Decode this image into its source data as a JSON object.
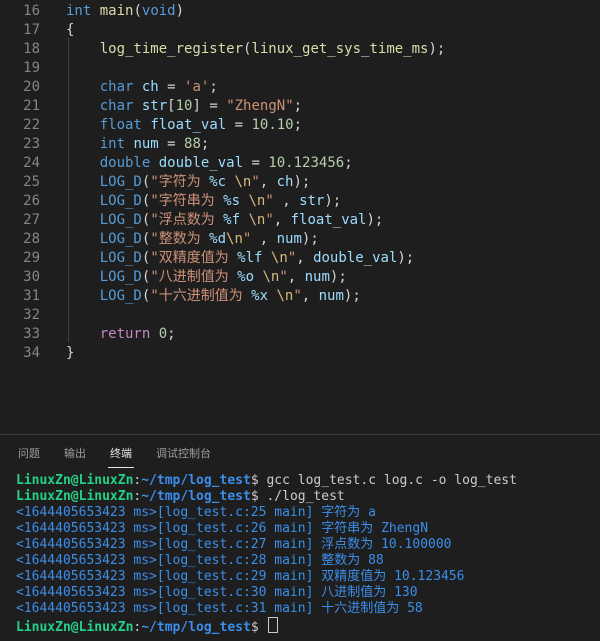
{
  "editor": {
    "lines": [
      {
        "n": "16",
        "t": [
          [
            "kw",
            "int"
          ],
          [
            "pun",
            " "
          ],
          [
            "fn",
            "main"
          ],
          [
            "pun",
            "("
          ],
          [
            "kw",
            "void"
          ],
          [
            "pun",
            ")"
          ]
        ]
      },
      {
        "n": "17",
        "t": [
          [
            "pun",
            "{"
          ]
        ]
      },
      {
        "n": "18",
        "t": [
          [
            "pun",
            "    "
          ],
          [
            "fn",
            "log_time_register"
          ],
          [
            "pun",
            "("
          ],
          [
            "fn",
            "linux_get_sys_time_ms"
          ],
          [
            "pun",
            ");"
          ]
        ]
      },
      {
        "n": "19",
        "t": []
      },
      {
        "n": "20",
        "t": [
          [
            "pun",
            "    "
          ],
          [
            "kw",
            "char"
          ],
          [
            "pun",
            " "
          ],
          [
            "var",
            "ch"
          ],
          [
            "pun",
            " = "
          ],
          [
            "str",
            "'a'"
          ],
          [
            "pun",
            ";"
          ]
        ]
      },
      {
        "n": "21",
        "t": [
          [
            "pun",
            "    "
          ],
          [
            "kw",
            "char"
          ],
          [
            "pun",
            " "
          ],
          [
            "var",
            "str"
          ],
          [
            "pun",
            "["
          ],
          [
            "num",
            "10"
          ],
          [
            "pun",
            "] = "
          ],
          [
            "str",
            "\"ZhengN\""
          ],
          [
            "pun",
            ";"
          ]
        ]
      },
      {
        "n": "22",
        "t": [
          [
            "pun",
            "    "
          ],
          [
            "kw",
            "float"
          ],
          [
            "pun",
            " "
          ],
          [
            "var",
            "float_val"
          ],
          [
            "pun",
            " = "
          ],
          [
            "num",
            "10.10"
          ],
          [
            "pun",
            ";"
          ]
        ]
      },
      {
        "n": "23",
        "t": [
          [
            "pun",
            "    "
          ],
          [
            "kw",
            "int"
          ],
          [
            "pun",
            " "
          ],
          [
            "var",
            "num"
          ],
          [
            "pun",
            " = "
          ],
          [
            "num",
            "88"
          ],
          [
            "pun",
            ";"
          ]
        ]
      },
      {
        "n": "24",
        "t": [
          [
            "pun",
            "    "
          ],
          [
            "kw",
            "double"
          ],
          [
            "pun",
            " "
          ],
          [
            "var",
            "double_val"
          ],
          [
            "pun",
            " = "
          ],
          [
            "num",
            "10.123456"
          ],
          [
            "pun",
            ";"
          ]
        ]
      },
      {
        "n": "25",
        "t": [
          [
            "pun",
            "    "
          ],
          [
            "kw",
            "LOG_D"
          ],
          [
            "pun",
            "("
          ],
          [
            "str",
            "\"字符为 "
          ],
          [
            "var",
            "%c"
          ],
          [
            "pun",
            " "
          ],
          [
            "esc",
            "\\n"
          ],
          [
            "str",
            "\""
          ],
          [
            "pun",
            ", "
          ],
          [
            "var",
            "ch"
          ],
          [
            "pun",
            ");"
          ]
        ]
      },
      {
        "n": "26",
        "t": [
          [
            "pun",
            "    "
          ],
          [
            "kw",
            "LOG_D"
          ],
          [
            "pun",
            "("
          ],
          [
            "str",
            "\"字符串为 "
          ],
          [
            "var",
            "%s"
          ],
          [
            "pun",
            " "
          ],
          [
            "esc",
            "\\n"
          ],
          [
            "str",
            "\""
          ],
          [
            "pun",
            " , "
          ],
          [
            "var",
            "str"
          ],
          [
            "pun",
            ");"
          ]
        ]
      },
      {
        "n": "27",
        "t": [
          [
            "pun",
            "    "
          ],
          [
            "kw",
            "LOG_D"
          ],
          [
            "pun",
            "("
          ],
          [
            "str",
            "\"浮点数为 "
          ],
          [
            "var",
            "%f"
          ],
          [
            "pun",
            " "
          ],
          [
            "esc",
            "\\n"
          ],
          [
            "str",
            "\""
          ],
          [
            "pun",
            ", "
          ],
          [
            "var",
            "float_val"
          ],
          [
            "pun",
            ");"
          ]
        ]
      },
      {
        "n": "28",
        "t": [
          [
            "pun",
            "    "
          ],
          [
            "kw",
            "LOG_D"
          ],
          [
            "pun",
            "("
          ],
          [
            "str",
            "\"整数为 "
          ],
          [
            "var",
            "%d"
          ],
          [
            "esc",
            "\\n"
          ],
          [
            "str",
            "\""
          ],
          [
            "pun",
            " , "
          ],
          [
            "var",
            "num"
          ],
          [
            "pun",
            ");"
          ]
        ]
      },
      {
        "n": "29",
        "t": [
          [
            "pun",
            "    "
          ],
          [
            "kw",
            "LOG_D"
          ],
          [
            "pun",
            "("
          ],
          [
            "str",
            "\"双精度值为 "
          ],
          [
            "var",
            "%lf"
          ],
          [
            "pun",
            " "
          ],
          [
            "esc",
            "\\n"
          ],
          [
            "str",
            "\""
          ],
          [
            "pun",
            ", "
          ],
          [
            "var",
            "double_val"
          ],
          [
            "pun",
            ");"
          ]
        ]
      },
      {
        "n": "30",
        "t": [
          [
            "pun",
            "    "
          ],
          [
            "kw",
            "LOG_D"
          ],
          [
            "pun",
            "("
          ],
          [
            "str",
            "\"八进制值为 "
          ],
          [
            "var",
            "%o"
          ],
          [
            "pun",
            " "
          ],
          [
            "esc",
            "\\n"
          ],
          [
            "str",
            "\""
          ],
          [
            "pun",
            ", "
          ],
          [
            "var",
            "num"
          ],
          [
            "pun",
            ");"
          ]
        ]
      },
      {
        "n": "31",
        "t": [
          [
            "pun",
            "    "
          ],
          [
            "kw",
            "LOG_D"
          ],
          [
            "pun",
            "("
          ],
          [
            "str",
            "\"十六进制值为 "
          ],
          [
            "var",
            "%x"
          ],
          [
            "pun",
            " "
          ],
          [
            "esc",
            "\\n"
          ],
          [
            "str",
            "\""
          ],
          [
            "pun",
            ", "
          ],
          [
            "var",
            "num"
          ],
          [
            "pun",
            ");"
          ]
        ]
      },
      {
        "n": "32",
        "t": []
      },
      {
        "n": "33",
        "t": [
          [
            "pun",
            "    "
          ],
          [
            "kw2",
            "return"
          ],
          [
            "pun",
            " "
          ],
          [
            "num",
            "0"
          ],
          [
            "pun",
            ";"
          ]
        ]
      },
      {
        "n": "34",
        "t": [
          [
            "pun",
            "}"
          ]
        ]
      }
    ]
  },
  "panel": {
    "tabs": [
      {
        "label": "问题",
        "active": false
      },
      {
        "label": "输出",
        "active": false
      },
      {
        "label": "终端",
        "active": true
      },
      {
        "label": "调试控制台",
        "active": false
      }
    ]
  },
  "terminal": {
    "lines": [
      {
        "kind": "prompt",
        "user": "LinuxZn@LinuxZn",
        "sep": ":",
        "path": "~/tmp/log_test",
        "sym": "$",
        "cmd": " gcc log_test.c log.c -o log_test"
      },
      {
        "kind": "prompt",
        "user": "LinuxZn@LinuxZn",
        "sep": ":",
        "path": "~/tmp/log_test",
        "sym": "$",
        "cmd": " ./log_test"
      },
      {
        "kind": "log",
        "text": "<1644405653423 ms>[log_test.c:25 main] 字符为 a"
      },
      {
        "kind": "log",
        "text": "<1644405653423 ms>[log_test.c:26 main] 字符串为 ZhengN"
      },
      {
        "kind": "log",
        "text": "<1644405653423 ms>[log_test.c:27 main] 浮点数为 10.100000"
      },
      {
        "kind": "log",
        "text": "<1644405653423 ms>[log_test.c:28 main] 整数为 88"
      },
      {
        "kind": "log",
        "text": "<1644405653423 ms>[log_test.c:29 main] 双精度值为 10.123456"
      },
      {
        "kind": "log",
        "text": "<1644405653423 ms>[log_test.c:30 main] 八进制值为 130"
      },
      {
        "kind": "log",
        "text": "<1644405653423 ms>[log_test.c:31 main] 十六进制值为 58"
      },
      {
        "kind": "prompt",
        "user": "LinuxZn@LinuxZn",
        "sep": ":",
        "path": "~/tmp/log_test",
        "sym": "$",
        "cmd": " ",
        "cursor": true
      }
    ]
  }
}
